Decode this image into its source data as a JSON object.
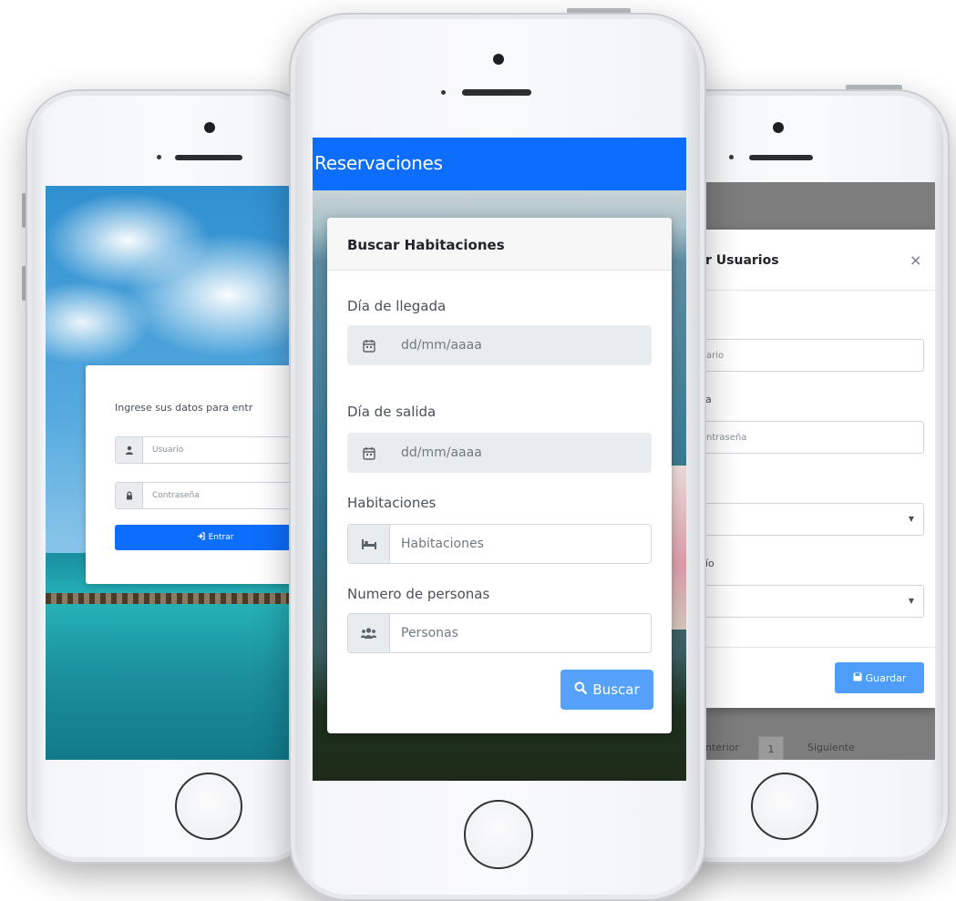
{
  "login": {
    "prompt": "Ingrese sus datos para entr",
    "username_placeholder": "Usuario",
    "password_placeholder": "Contraseña",
    "submit_label": "Entrar"
  },
  "reservations": {
    "app_title": "Reservaciones",
    "card_title": "Buscar Habitaciones",
    "arrival_label": "Día de llegada",
    "arrival_placeholder": "dd/mm/aaaa",
    "departure_label": "Día de salida",
    "departure_placeholder": "dd/mm/aaaa",
    "rooms_label": "Habitaciones",
    "rooms_placeholder": "Habitaciones",
    "people_label": "Numero de personas",
    "people_placeholder": "Personas",
    "search_label": "Buscar"
  },
  "users_modal": {
    "title": "r Usuarios",
    "close": "×",
    "user_placeholder": "ario",
    "password_label_fragment": "a",
    "password_placeholder": "ntraseña",
    "type_label_fragment": "ío",
    "save_label": "Guardar",
    "pager_prev": "nterior",
    "pager_page": "1",
    "pager_next": "Siguiente"
  },
  "colors": {
    "primary": "#0d6efd",
    "primary_light": "#56a2fb",
    "addon_bg": "#e9ecef"
  },
  "icons": {
    "user": "user-icon",
    "lock": "lock-icon",
    "login": "sign-in-icon",
    "calendar": "calendar-icon",
    "bed": "bed-icon",
    "users": "users-icon",
    "search": "search-icon",
    "save": "save-icon",
    "close": "close-icon"
  }
}
